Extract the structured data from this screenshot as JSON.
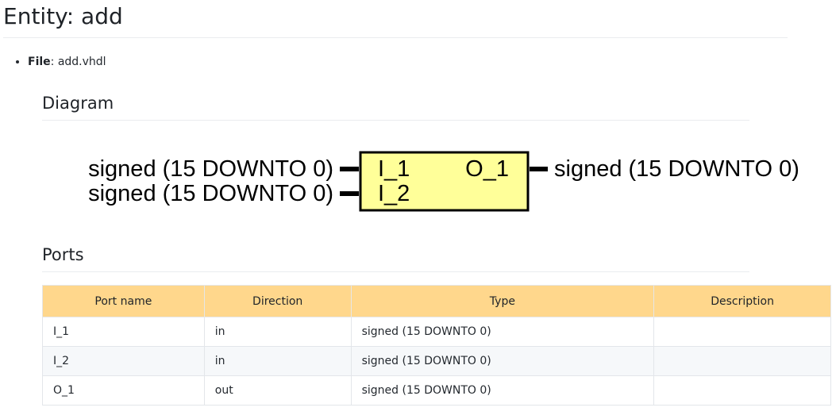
{
  "title": "Entity: add",
  "meta": {
    "file_label": "File",
    "file_value": "add.vhdl"
  },
  "sections": {
    "diagram": "Diagram",
    "ports": "Ports"
  },
  "diagram": {
    "entity_color": "#ffff99",
    "inputs": [
      {
        "name": "I_1",
        "type": "signed (15 DOWNTO 0)"
      },
      {
        "name": "I_2",
        "type": "signed (15 DOWNTO 0)"
      }
    ],
    "outputs": [
      {
        "name": "O_1",
        "type": "signed (15 DOWNTO 0)"
      }
    ]
  },
  "ports_table": {
    "header_color": "#ffd78c",
    "headers": [
      "Port name",
      "Direction",
      "Type",
      "Description"
    ],
    "rows": [
      [
        "I_1",
        "in",
        "signed (15 DOWNTO 0)",
        ""
      ],
      [
        "I_2",
        "in",
        "signed (15 DOWNTO 0)",
        ""
      ],
      [
        "O_1",
        "out",
        "signed (15 DOWNTO 0)",
        ""
      ]
    ]
  }
}
